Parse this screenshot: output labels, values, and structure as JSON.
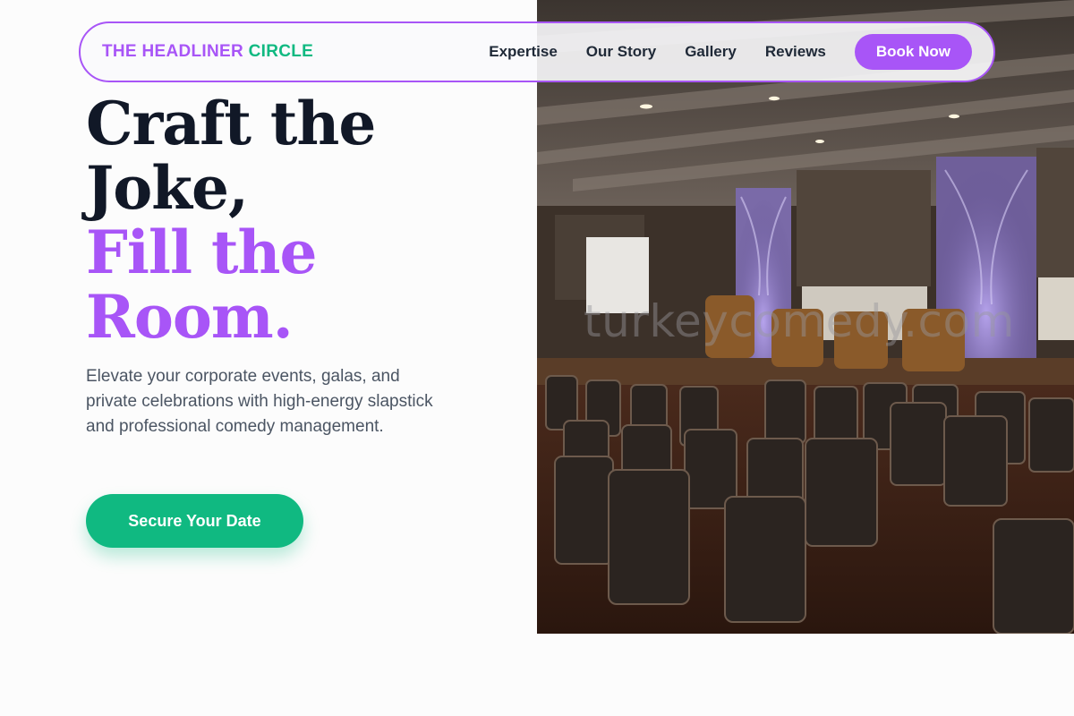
{
  "brand": {
    "name_main": "THE HEADLINER",
    "name_accent": "CIRCLE"
  },
  "nav": {
    "links": [
      {
        "label": "Expertise"
      },
      {
        "label": "Our Story"
      },
      {
        "label": "Gallery"
      },
      {
        "label": "Reviews"
      }
    ],
    "cta_label": "Book Now"
  },
  "hero": {
    "title_lines": [
      "Craft the",
      "Joke,",
      "Fill the",
      "Room."
    ],
    "subtitle": "Elevate your corporate events, galas, and private celebrations with high-energy slapstick and professional comedy management.",
    "cta_label": "Secure Your Date",
    "image": {
      "alt": "Banquet hall with rows of chairs facing a stage lit with purple uplighting",
      "watermark": "turkeycomedy.com"
    }
  },
  "colors": {
    "accent_purple": "#a855f7",
    "accent_green": "#10b981",
    "heading_dark": "#111827",
    "body_text": "#4b5563",
    "background": "#fcfcfc"
  }
}
